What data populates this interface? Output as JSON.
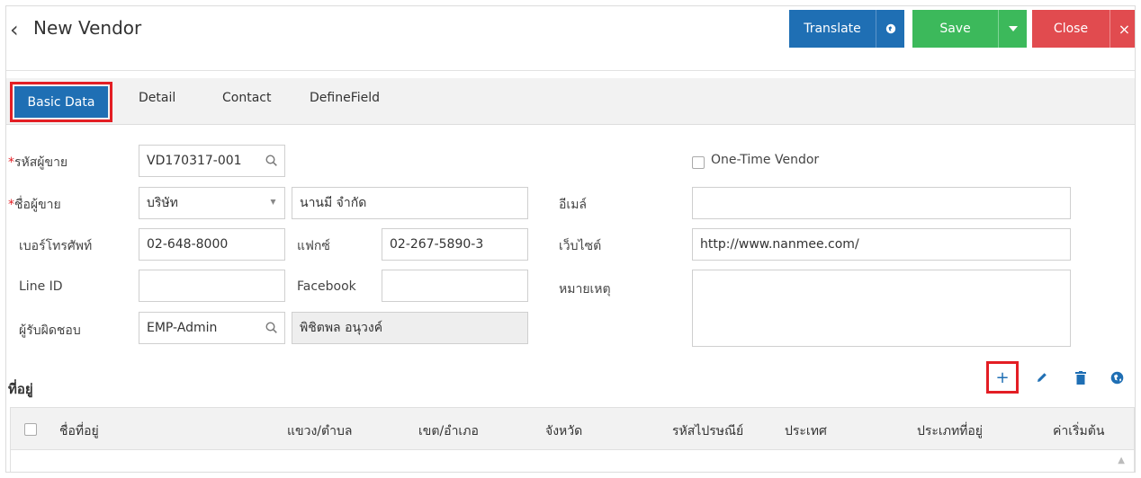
{
  "header": {
    "back_icon": "chevron-left-icon",
    "back_glyph": "‹",
    "title": "New Vendor",
    "translate_label": "Translate",
    "save_label": "Save",
    "close_label": "Close",
    "close_glyph": "×",
    "colors": {
      "translate": "#1f6fb4",
      "save": "#3cb95b",
      "close": "#e14b4f"
    }
  },
  "tabs": [
    {
      "label": "Basic Data",
      "active": true
    },
    {
      "label": "Detail"
    },
    {
      "label": "Contact"
    },
    {
      "label": "DefineField"
    }
  ],
  "form": {
    "vendor_code": {
      "label": "รหัสผู้ขาย",
      "required": true,
      "value": "VD170317-001",
      "icon": "search-icon"
    },
    "one_time_vendor": {
      "label": "One-Time Vendor",
      "checked": false
    },
    "vendor_name": {
      "label": "ชื่อผู้ขาย",
      "required": true,
      "prefix_value": "บริษัท",
      "value": "นานมี จำกัด"
    },
    "email": {
      "label": "อีเมล์",
      "value": ""
    },
    "phone": {
      "label": "เบอร์โทรศัพท์",
      "value": "02-648-8000"
    },
    "fax": {
      "label": "แฟกซ์",
      "value": "02-267-5890-3"
    },
    "website": {
      "label": "เว็บไซต์",
      "value": "http://www.nanmee.com/"
    },
    "line_id": {
      "label": "Line ID",
      "value": ""
    },
    "facebook": {
      "label": "Facebook",
      "value": ""
    },
    "note": {
      "label": "หมายเหตุ",
      "value": ""
    },
    "owner": {
      "label": "ผู้รับผิดชอบ",
      "code": "EMP-Admin",
      "name": "พิชิตพล อนุวงค์",
      "icon": "search-icon"
    }
  },
  "address": {
    "title": "ที่อยู่",
    "tools": [
      "add-icon",
      "edit-icon",
      "delete-icon",
      "globe-icon"
    ],
    "add_glyph": "+",
    "columns": [
      "ชื่อที่อยู่",
      "แขวง/ตำบล",
      "เขต/อำเภอ",
      "จังหวัด",
      "รหัสไปรษณีย์",
      "ประเทศ",
      "ประเภทที่อยู่",
      "ค่าเริ่มต้น"
    ]
  }
}
